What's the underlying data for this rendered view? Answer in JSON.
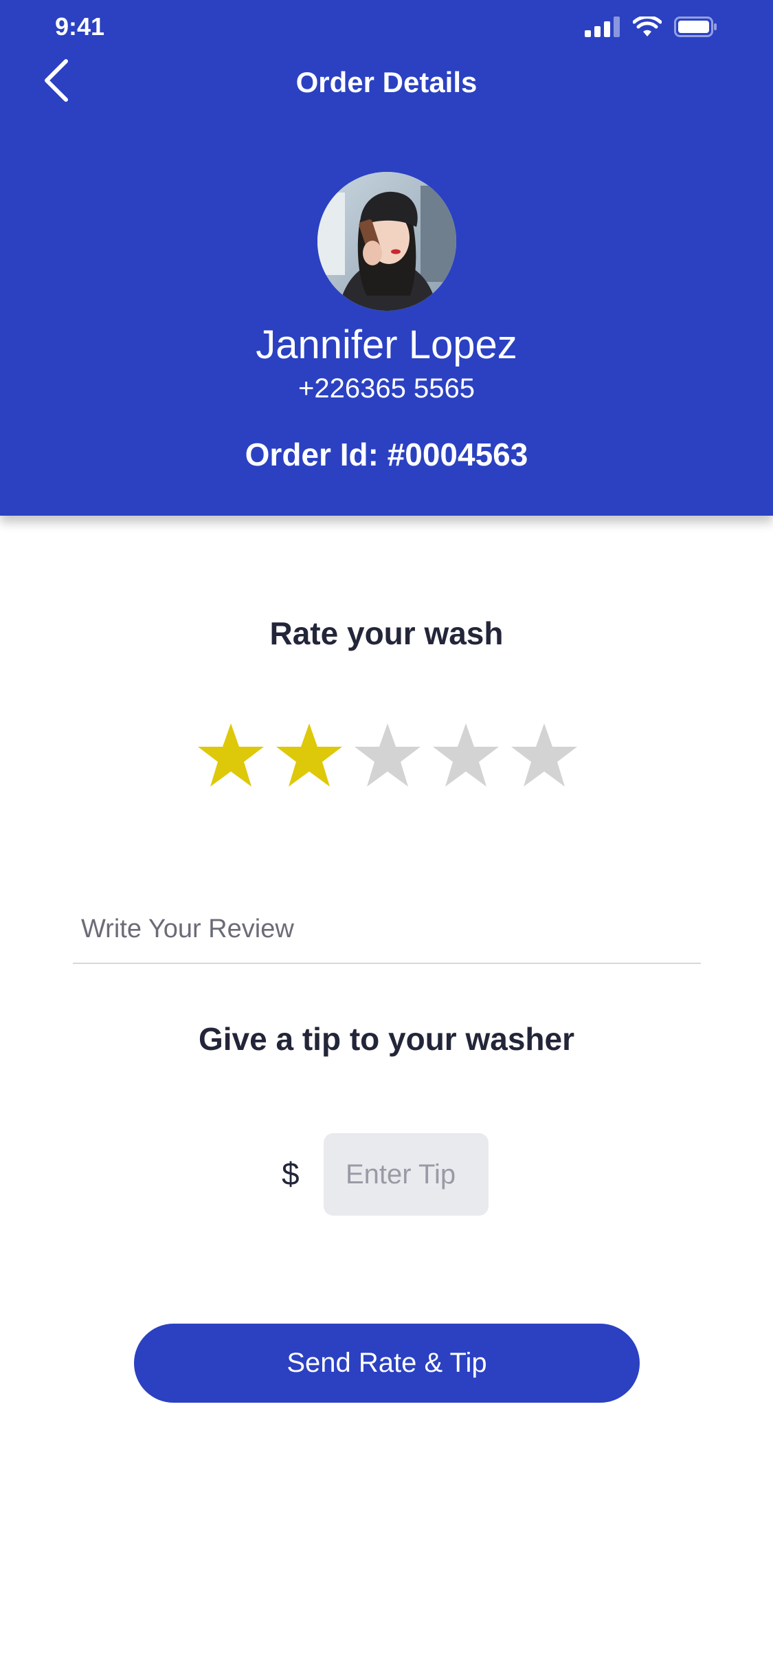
{
  "status_bar": {
    "time": "9:41"
  },
  "header": {
    "title": "Order Details",
    "back_icon": "chevron-left-icon"
  },
  "customer": {
    "name": "Jannifer Lopez",
    "phone": "+226365 5565",
    "order_id": "Order Id: #0004563"
  },
  "rating": {
    "heading": "Rate your wash",
    "value": 2,
    "max": 5,
    "filled_color": "#dec80a",
    "empty_color": "#d3d3d3"
  },
  "review": {
    "placeholder": "Write Your Review",
    "value": ""
  },
  "tip": {
    "heading": "Give a tip to your washer",
    "currency_symbol": "$",
    "placeholder": "Enter Tip",
    "value": ""
  },
  "actions": {
    "send_label": "Send Rate & Tip"
  },
  "colors": {
    "primary": "#2b41c2",
    "text_dark": "#232639"
  }
}
